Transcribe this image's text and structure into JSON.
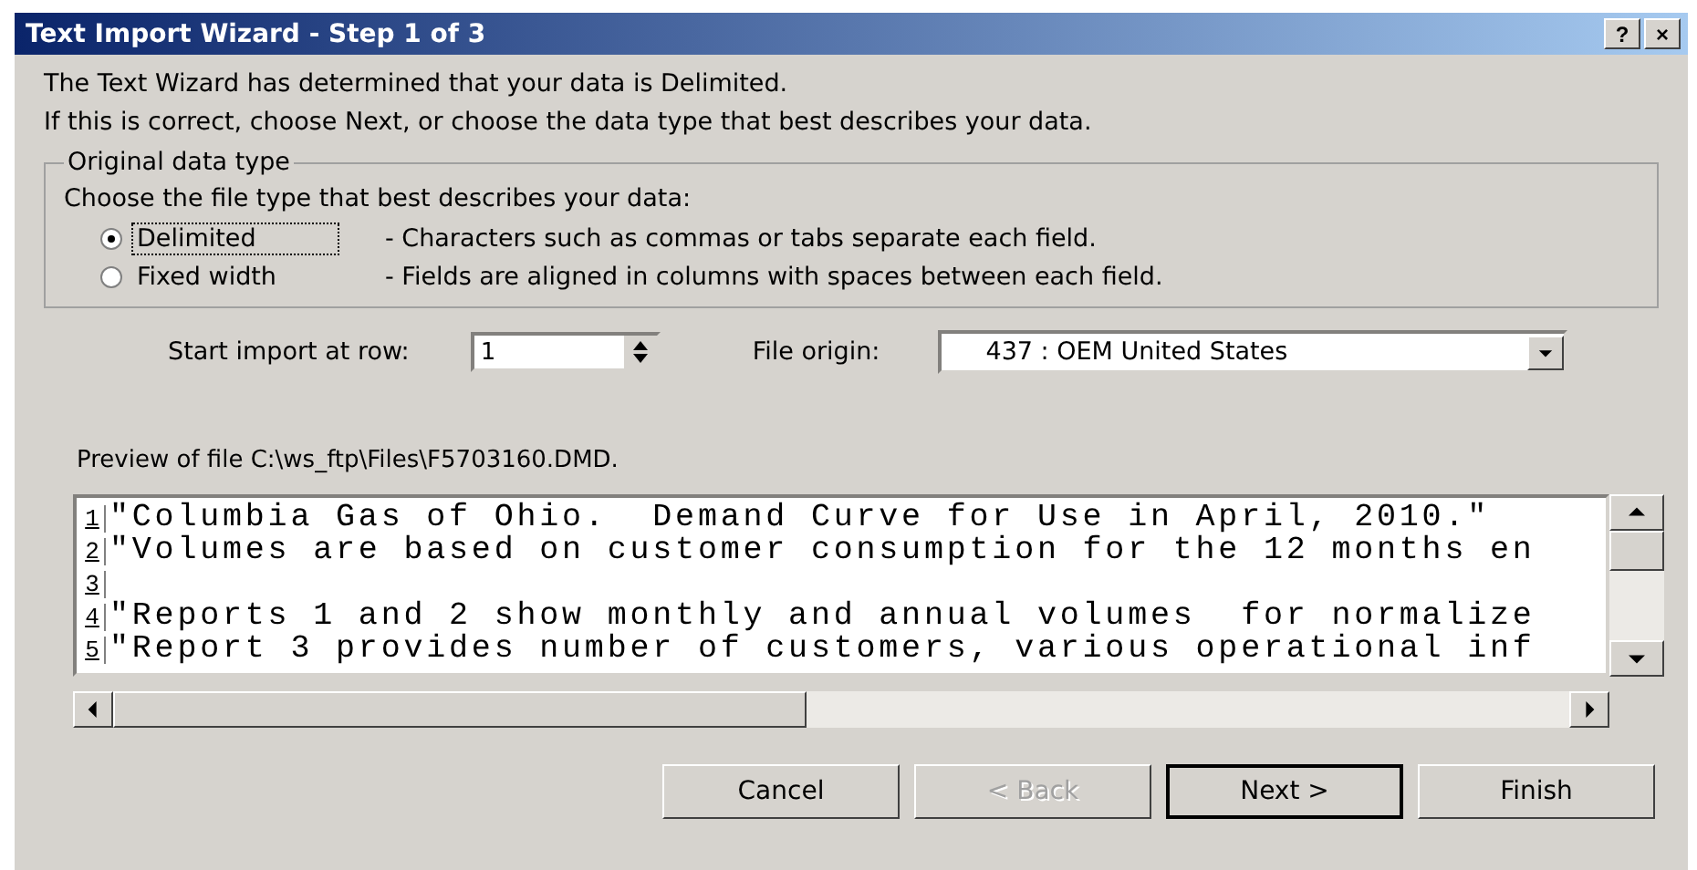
{
  "window": {
    "title": "Text Import Wizard - Step 1 of 3",
    "help_button": "?",
    "close_button": "×"
  },
  "intro": [
    "The Text Wizard has determined that your data is Delimited.",
    "If this is correct, choose Next, or choose the data type that best describes your data."
  ],
  "data_type": {
    "legend": "Original data type",
    "prompt": "Choose the file type that best describes your data:",
    "options": [
      {
        "label": "Delimited",
        "description": "- Characters such as commas or tabs separate each field.",
        "selected": true
      },
      {
        "label": "Fixed width",
        "description": "- Fields are aligned in columns with spaces between each field.",
        "selected": false
      }
    ]
  },
  "start_row": {
    "label": "Start import at row:",
    "value": "1"
  },
  "file_origin": {
    "label": "File origin:",
    "value": "437 : OEM United States"
  },
  "preview": {
    "label": "Preview of file C:\\ws_ftp\\Files\\F5703160.DMD.",
    "lines": [
      {
        "number": "1",
        "text": "\"Columbia Gas of Ohio.  Demand Curve for Use in April, 2010.\""
      },
      {
        "number": "2",
        "text": "\"Volumes are based on customer consumption for the 12 months en"
      },
      {
        "number": "3"
      },
      {
        "number": "4",
        "text": "\"Reports 1 and 2 show monthly and annual volumes  for normalize"
      },
      {
        "number": "5",
        "text": "\"Report 3 provides number of customers, various operational inf"
      }
    ]
  },
  "buttons": [
    {
      "label": "Cancel",
      "disabled": false,
      "default": false
    },
    {
      "label": "< Back",
      "disabled": true,
      "default": false
    },
    {
      "label": "Next >",
      "disabled": false,
      "default": true
    },
    {
      "label": "Finish",
      "disabled": false,
      "default": false
    }
  ]
}
